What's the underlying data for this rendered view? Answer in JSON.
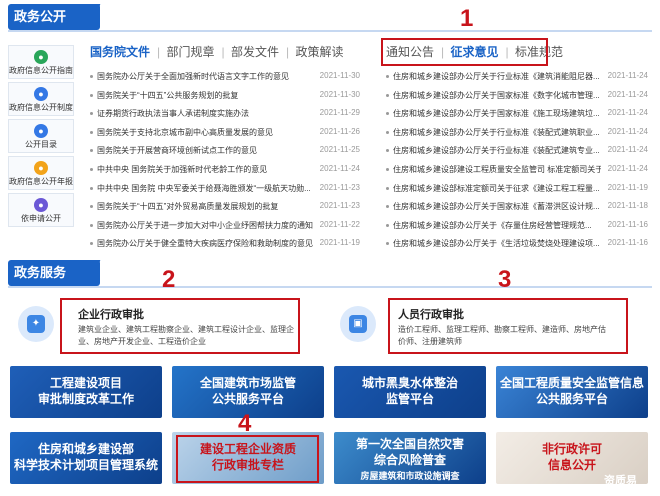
{
  "gov_section": {
    "title": "政务公开"
  },
  "service_section": {
    "title": "政务服务"
  },
  "sidebar": {
    "items": [
      {
        "label": "政府信息公开指南",
        "color": "#29a65a"
      },
      {
        "label": "政府信息公开制度",
        "color": "#3478e5"
      },
      {
        "label": "公开目录",
        "color": "#3478e5"
      },
      {
        "label": "政府信息公开年报",
        "color": "#f2a31a"
      },
      {
        "label": "依申请公开",
        "color": "#6b58d6"
      }
    ]
  },
  "left_tabs": [
    "国务院文件",
    "部门规章",
    "部发文件",
    "政策解读"
  ],
  "right_tabs": [
    "通知公告",
    "征求意见",
    "标准规范"
  ],
  "left_news": [
    {
      "title": "国务院办公厅关于全面加强新时代语言文字工作的意见",
      "date": "2021-11-30"
    },
    {
      "title": "国务院关于“十四五”公共服务规划的批复",
      "date": "2021-11-30"
    },
    {
      "title": "证券期货行政执法当事人承诺制度实施办法",
      "date": "2021-11-29"
    },
    {
      "title": "国务院关于支持北京城市副中心高质量发展的意见",
      "date": "2021-11-26"
    },
    {
      "title": "国务院关于开展营商环境创新试点工作的意见",
      "date": "2021-11-25"
    },
    {
      "title": "中共中央 国务院关于加强新时代老龄工作的意见",
      "date": "2021-11-24"
    },
    {
      "title": "中共中央 国务院 中央军委关于给聂海胜颁发“一级航天功勋...",
      "date": "2021-11-23"
    },
    {
      "title": "国务院关于“十四五”对外贸易高质量发展规划的批复",
      "date": "2021-11-23"
    },
    {
      "title": "国务院办公厅关于进一步加大对中小企业纾困帮扶力度的通知",
      "date": "2021-11-22"
    },
    {
      "title": "国务院办公厅关于健全重特大疾病医疗保险和救助制度的意见",
      "date": "2021-11-19"
    }
  ],
  "right_news": [
    {
      "title": "住房和城乡建设部办公厅关于行业标准《建筑消能阻尼器...",
      "date": "2021-11-24"
    },
    {
      "title": "住房和城乡建设部办公厅关于国家标准《数字化城市管理...",
      "date": "2021-11-24"
    },
    {
      "title": "住房和城乡建设部办公厅关于国家标准《施工现场建筑垃...",
      "date": "2021-11-24"
    },
    {
      "title": "住房和城乡建设部办公厅关于行业标准《装配式建筑职业...",
      "date": "2021-11-24"
    },
    {
      "title": "住房和城乡建设部办公厅关于行业标准《装配式建筑专业...",
      "date": "2021-11-24"
    },
    {
      "title": "住房和城乡建设部建设工程质量安全监管司 标准定额司关于...",
      "date": "2021-11-24"
    },
    {
      "title": "住房和城乡建设部标准定额司关于征求《建设工程工程量...",
      "date": "2021-11-19"
    },
    {
      "title": "住房和城乡建设部办公厅关于国家标准《蓄滞洪区设计规...",
      "date": "2021-11-18"
    },
    {
      "title": "住房和城乡建设部办公厅关于《存量住房经营管理规范...",
      "date": "2021-11-16"
    },
    {
      "title": "住房和城乡建设部办公厅关于《生活垃圾焚烧处理建设项...",
      "date": "2021-11-16"
    }
  ],
  "cards": {
    "enterprise": {
      "title": "企业行政审批",
      "desc": "建筑业企业、建筑工程勘察企业、建筑工程设计企业、监理企业、房地产开发企业、工程造价企业"
    },
    "personnel": {
      "title": "人员行政审批",
      "desc": "造价工程师、监理工程师、勘察工程师、建造师、房地产估价师、注册建筑师"
    }
  },
  "banners": [
    {
      "line1": "工程建设项目",
      "line2": "审批制度改革工作",
      "color": "#1f5fb8"
    },
    {
      "line1": "全国建筑市场监管",
      "line2": "公共服务平台",
      "color": "#2474c9"
    },
    {
      "line1": "城市黑臭水体整治",
      "line2": "监管平台",
      "color": "#1a58b0"
    },
    {
      "line1": "全国工程质量安全监管信息",
      "line2": "公共服务平台",
      "color": "#3a84d6"
    },
    {
      "line1": "住房和城乡建设部",
      "line2": "科学技术计划项目管理系统",
      "color": "#1f68c4"
    },
    {
      "line1": "建设工程企业资质",
      "line2": "行政审批专栏",
      "color": "#8fb6d8"
    },
    {
      "line1": "第一次全国自然灾害",
      "line2": "综合风险普查",
      "line3": "房屋建筑和市政设施调查",
      "color": "#3d8ccc"
    },
    {
      "line1": "非行政许可",
      "line2": "信息公开",
      "color": "#e9e4de"
    }
  ],
  "annotations": [
    "1",
    "2",
    "3",
    "4"
  ],
  "watermark": "资质易",
  "colors": {
    "brand": "#1a63c6",
    "annotation": "#c8141b"
  }
}
